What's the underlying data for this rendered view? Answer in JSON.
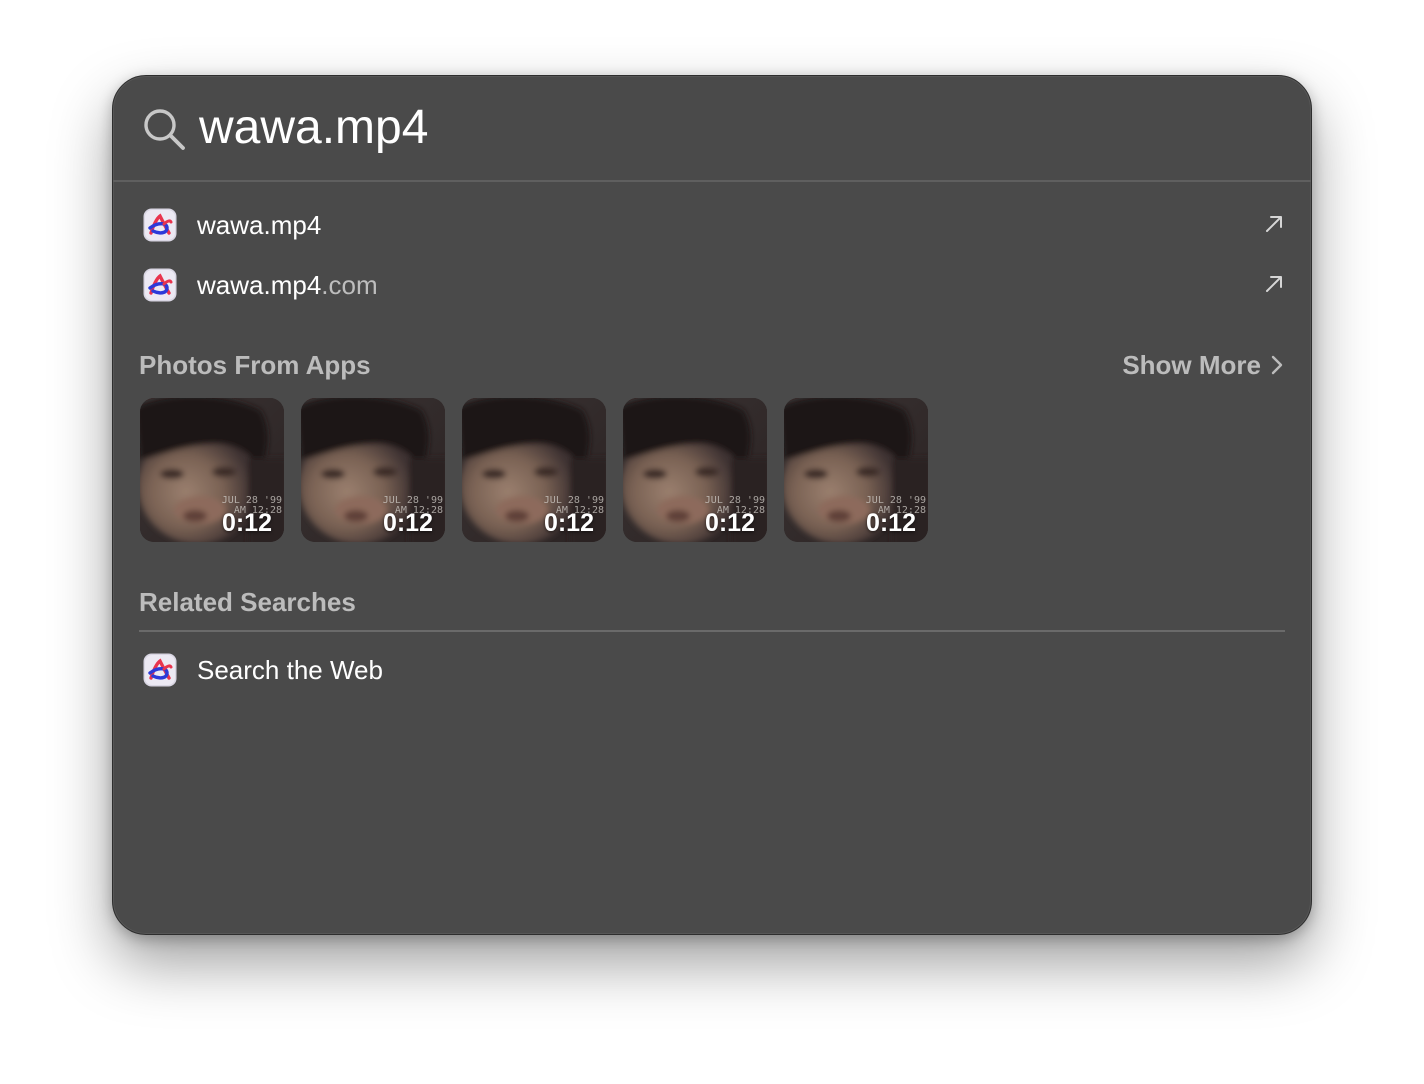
{
  "search": {
    "query": "wawa.mp4"
  },
  "results": [
    {
      "label": "wawa.mp4",
      "suffix": "",
      "icon": "arc-browser-icon",
      "action_icon": "open-arrow-icon"
    },
    {
      "label": "wawa.mp4",
      "suffix": ".com",
      "icon": "arc-browser-icon",
      "action_icon": "open-arrow-icon"
    }
  ],
  "photos_section": {
    "title": "Photos From Apps",
    "show_more_label": "Show More",
    "thumbnails": [
      {
        "duration": "0:12",
        "stamp_line1": "JUL 28 '99",
        "stamp_line2": "AM 12:28"
      },
      {
        "duration": "0:12",
        "stamp_line1": "JUL 28 '99",
        "stamp_line2": "AM 12:28"
      },
      {
        "duration": "0:12",
        "stamp_line1": "JUL 28 '99",
        "stamp_line2": "AM 12:28"
      },
      {
        "duration": "0:12",
        "stamp_line1": "JUL 28 '99",
        "stamp_line2": "AM 12:28"
      },
      {
        "duration": "0:12",
        "stamp_line1": "JUL 28 '99",
        "stamp_line2": "AM 12:28"
      }
    ]
  },
  "related_section": {
    "title": "Related Searches",
    "items": [
      {
        "label": "Search the Web",
        "icon": "arc-browser-icon"
      }
    ]
  },
  "colors": {
    "panel_bg": "#4a4a4a",
    "text_primary": "#ffffff",
    "text_secondary": "#bcbcbc"
  }
}
